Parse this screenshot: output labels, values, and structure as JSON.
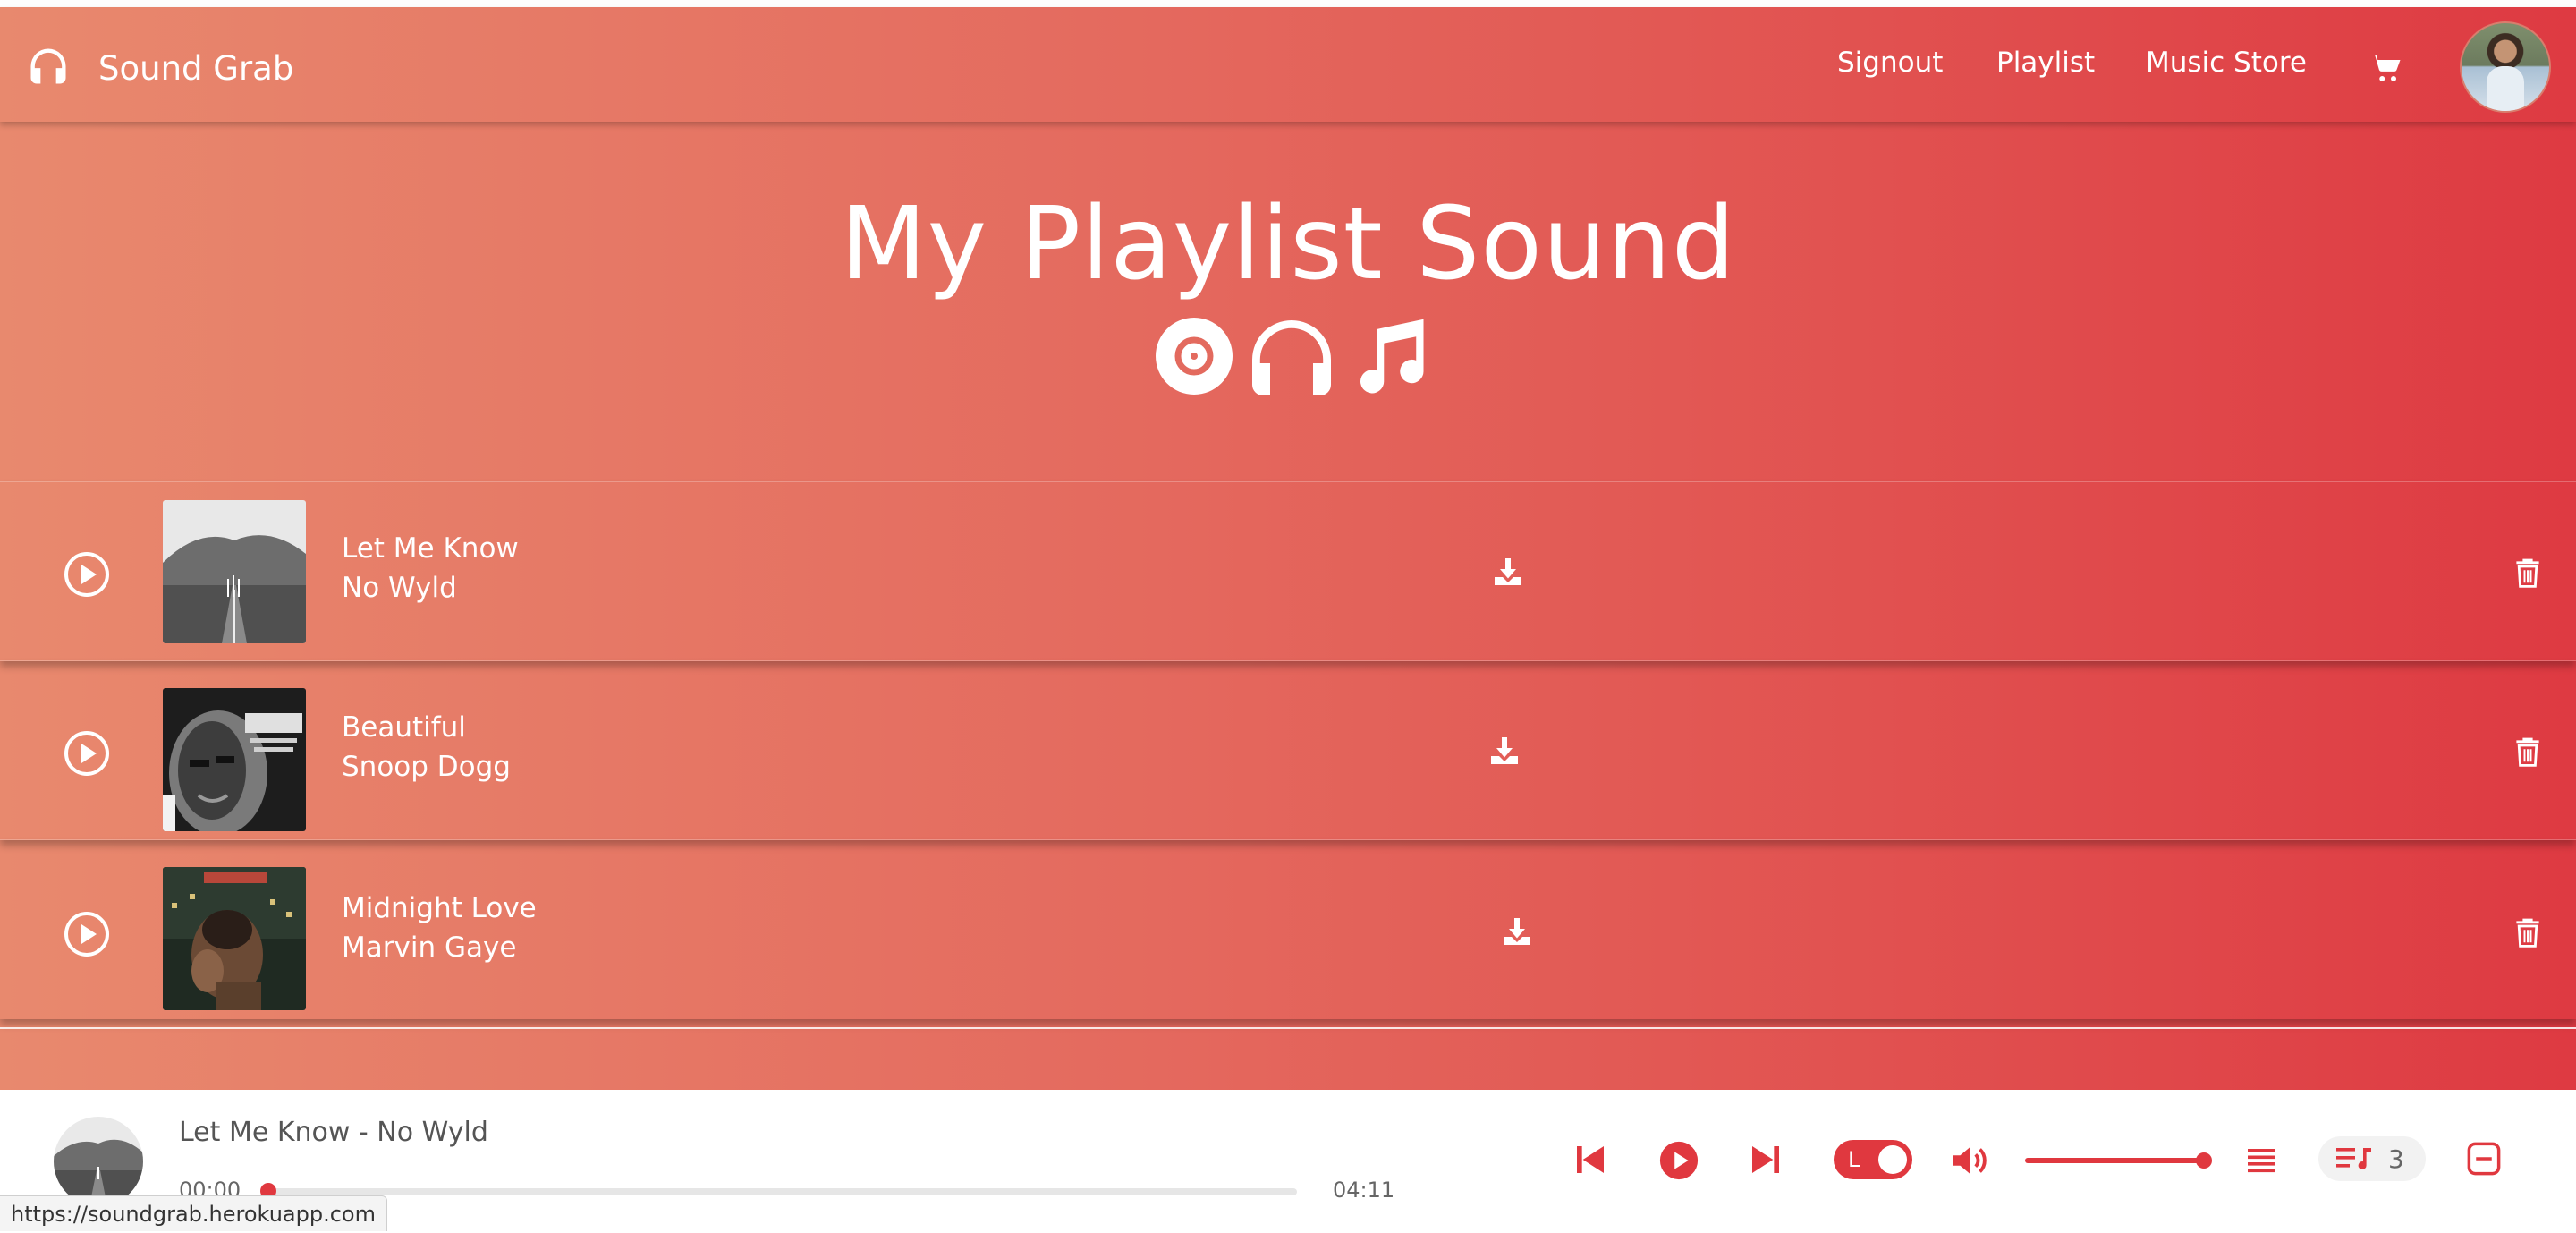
{
  "brand": {
    "name": "Sound Grab",
    "icon": "headphones-icon"
  },
  "nav": {
    "links": [
      "Signout",
      "Playlist",
      "Music Store"
    ],
    "cart_icon": "cart-icon",
    "avatar": "user-avatar"
  },
  "hero": {
    "title": "My Playlist Sound",
    "icons": [
      "vinyl-record-icon",
      "headphones-icon",
      "music-note-icon"
    ]
  },
  "tracks": [
    {
      "title": "Let Me Know",
      "artist": "No Wyld"
    },
    {
      "title": "Beautiful",
      "artist": "Snoop Dogg"
    },
    {
      "title": "Midnight Love",
      "artist": "Marvin Gaye"
    }
  ],
  "player": {
    "now_playing": "Let Me Know - No Wyld",
    "current_time": "00:00",
    "total_time": "04:11",
    "progress": 0.0,
    "volume": 1.0,
    "toggle_letter": "L",
    "queue_count": "3"
  },
  "status_bar": {
    "url": "https://soundgrab.herokuapp.com"
  },
  "colors": {
    "accent": "#e0383f",
    "gradient_start": "#e8896e",
    "gradient_end": "#de3a42"
  }
}
